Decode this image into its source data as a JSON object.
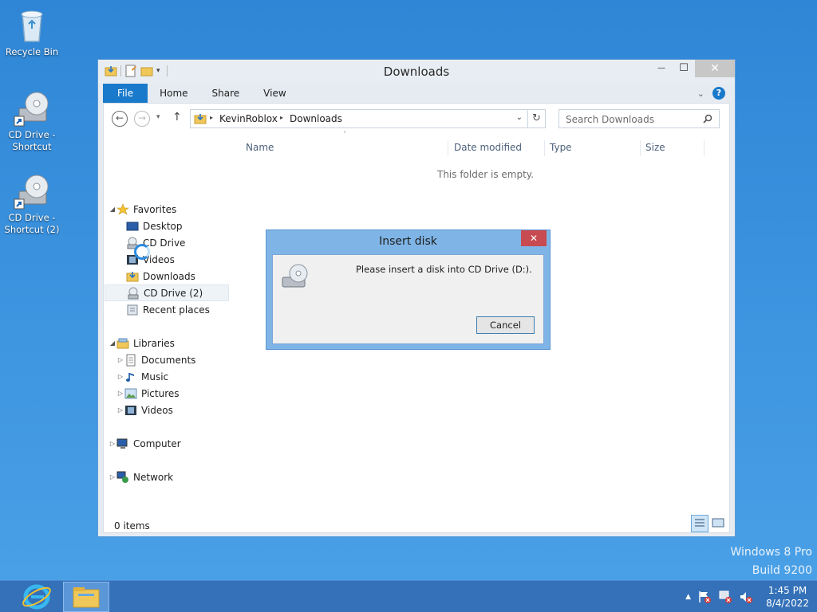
{
  "desktop": {
    "icons": [
      {
        "label": "Recycle Bin"
      },
      {
        "label": "CD Drive -\nShortcut"
      },
      {
        "label": "CD Drive -\nShortcut (2)"
      }
    ],
    "watermark": {
      "line1": "Windows 8 Pro",
      "line2": "Build 9200"
    }
  },
  "explorer": {
    "title": "Downloads",
    "controls": {
      "minimize": "—",
      "maximize": "☐",
      "close": "✕"
    },
    "tabs": {
      "file": "File",
      "home": "Home",
      "share": "Share",
      "view": "View"
    },
    "breadcrumb": {
      "root": "KevinRoblox",
      "current": "Downloads"
    },
    "search_placeholder": "Search Downloads",
    "nav": {
      "favorites": "Favorites",
      "desktop": "Desktop",
      "cd_drive": "CD Drive",
      "videos": "Videos",
      "downloads": "Downloads",
      "cd_drive_2": "CD Drive (2)",
      "recent": "Recent places",
      "libraries": "Libraries",
      "documents": "Documents",
      "music": "Music",
      "pictures": "Pictures",
      "lib_videos": "Videos",
      "computer": "Computer",
      "network": "Network"
    },
    "columns": {
      "name": "Name",
      "date": "Date modified",
      "type": "Type",
      "size": "Size"
    },
    "empty_message": "This folder is empty.",
    "status": "0 items"
  },
  "dialog": {
    "title": "Insert disk",
    "message": "Please insert a disk into CD Drive (D:).",
    "cancel": "Cancel"
  },
  "taskbar": {
    "time": "1:45 PM",
    "date": "8/4/2022"
  },
  "colors": {
    "accent": "#1979ca",
    "close_red": "#c74b50",
    "desktop": "#3b8fd8"
  }
}
